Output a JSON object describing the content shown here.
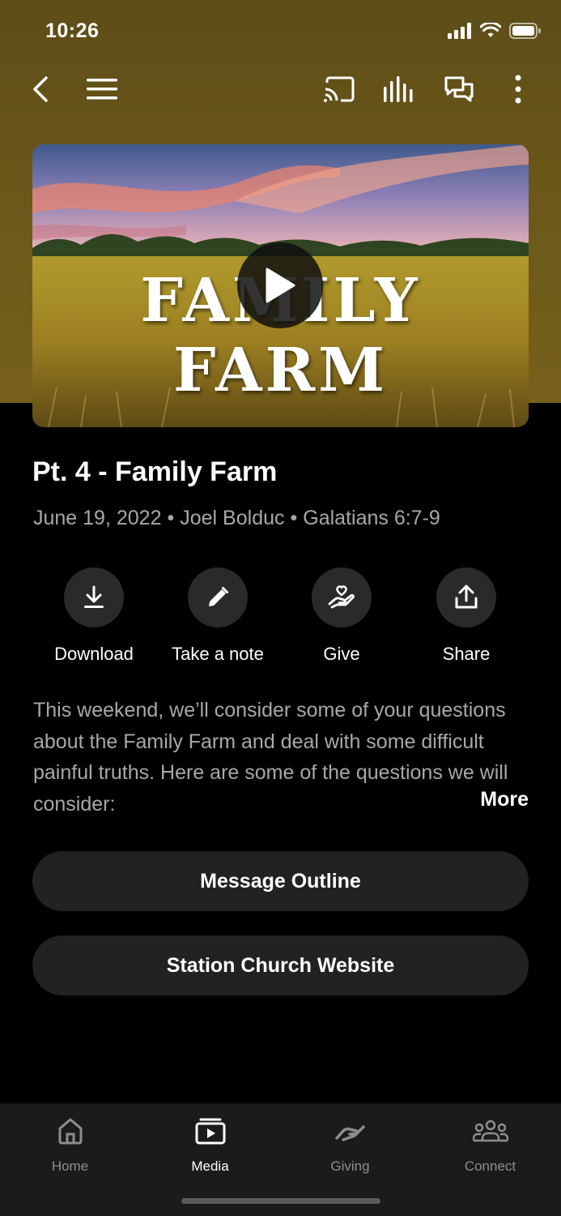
{
  "status_bar": {
    "time": "10:26"
  },
  "hero": {
    "title_text": "FAMILY FARM"
  },
  "message": {
    "title": "Pt. 4 - Family Farm",
    "date": "June 19, 2022",
    "speaker": "Joel Bolduc",
    "scripture": "Galatians 6:7-9",
    "separator": "•"
  },
  "actions": [
    {
      "label": "Download",
      "icon": "download-icon"
    },
    {
      "label": "Take a note",
      "icon": "pencil-icon"
    },
    {
      "label": "Give",
      "icon": "heart-hand-icon"
    },
    {
      "label": "Share",
      "icon": "share-icon"
    }
  ],
  "description": {
    "text": "This weekend, we’ll consider some of your questions about the Family Farm and deal with some difficult painful truths.  Here are some of the questions we will consider:",
    "more_label": "More"
  },
  "buttons": {
    "outline": "Message Outline",
    "website": "Station Church Website"
  },
  "tabs": [
    {
      "label": "Home",
      "icon": "home-icon",
      "active": false
    },
    {
      "label": "Media",
      "icon": "media-icon",
      "active": true
    },
    {
      "label": "Giving",
      "icon": "giving-icon",
      "active": false
    },
    {
      "label": "Connect",
      "icon": "connect-icon",
      "active": false
    }
  ],
  "colors": {
    "header_gold": "#6e5a1a",
    "background": "#000000",
    "secondary_text": "#a8a8a8",
    "button_bg": "#222222",
    "tabbar_bg": "#1b1b1b"
  }
}
